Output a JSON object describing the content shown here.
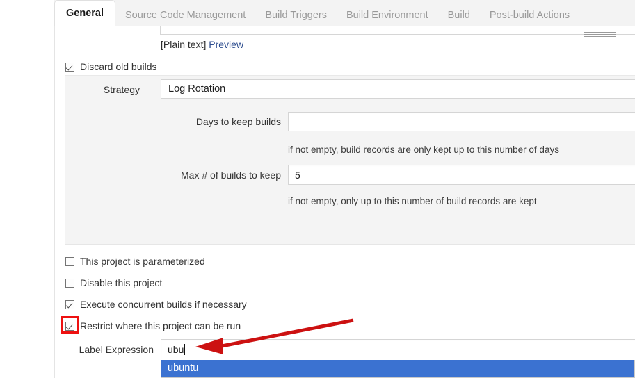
{
  "tabs": [
    {
      "label": "General",
      "active": true
    },
    {
      "label": "Source Code Management",
      "active": false
    },
    {
      "label": "Build Triggers",
      "active": false
    },
    {
      "label": "Build Environment",
      "active": false
    },
    {
      "label": "Build",
      "active": false
    },
    {
      "label": "Post-build Actions",
      "active": false
    }
  ],
  "description_footer": {
    "plain_text": "[Plain text]",
    "preview_link": "Preview"
  },
  "discard": {
    "checkbox_label": "Discard old builds",
    "checked": true,
    "strategy_label": "Strategy",
    "strategy_value": "Log Rotation",
    "days_label": "Days to keep builds",
    "days_value": "",
    "days_help": "if not empty, build records are only kept up to this number of days",
    "max_label": "Max # of builds to keep",
    "max_value": "5",
    "max_help": "if not empty, only up to this number of build records are kept"
  },
  "options": [
    {
      "label": "This project is parameterized",
      "checked": false
    },
    {
      "label": "Disable this project",
      "checked": false
    },
    {
      "label": "Execute concurrent builds if necessary",
      "checked": true
    },
    {
      "label": "Restrict where this project can be run",
      "checked": true
    }
  ],
  "label_expression": {
    "label": "Label Expression",
    "value": "ubu",
    "suggestions": [
      "ubuntu"
    ],
    "selected_suggestion": "ubuntu"
  },
  "annotations": {
    "highlight_color": "#ee1111",
    "arrow_color": "#cc1111"
  }
}
